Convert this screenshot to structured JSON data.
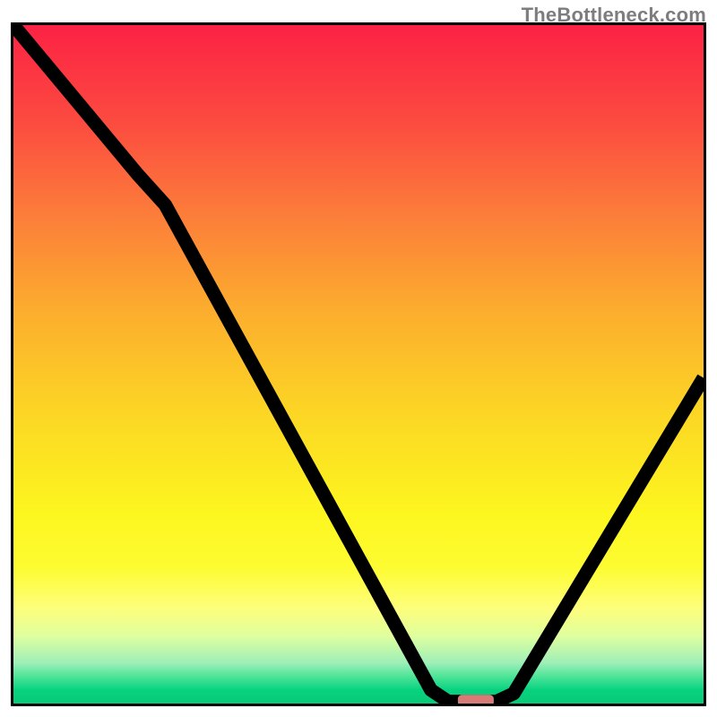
{
  "watermark": "TheBottleneck.com",
  "chart_data": {
    "type": "line",
    "title": "",
    "xlabel": "",
    "ylabel": "",
    "xlim": [
      0,
      100
    ],
    "ylim": [
      0,
      100
    ],
    "grid": false,
    "curve_points": [
      {
        "x": 0,
        "y": 100
      },
      {
        "x": 18,
        "y": 78
      },
      {
        "x": 22,
        "y": 73.5
      },
      {
        "x": 60.5,
        "y": 2
      },
      {
        "x": 63,
        "y": 0.3
      },
      {
        "x": 70,
        "y": 0.3
      },
      {
        "x": 72.5,
        "y": 1.5
      },
      {
        "x": 100,
        "y": 48
      }
    ],
    "marker": {
      "x_center": 67,
      "x_halfwidth": 2.6,
      "y": 0.4,
      "color": "#d87a78"
    },
    "background_gradient": [
      {
        "pos": 1.0,
        "color": "#fc2244"
      },
      {
        "pos": 0.0,
        "color": "#08c977"
      }
    ]
  }
}
